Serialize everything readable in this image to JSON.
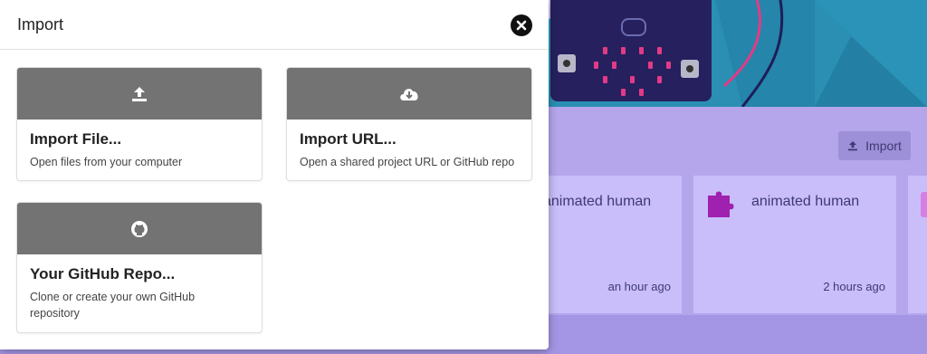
{
  "modal": {
    "title": "Import",
    "close_icon": "close-icon",
    "options": [
      {
        "title": "Import File...",
        "description": "Open files from your computer",
        "icon": "upload-icon"
      },
      {
        "title": "Import URL...",
        "description": "Open a shared project URL or GitHub repo",
        "icon": "cloud-download-icon"
      },
      {
        "title": "Your GitHub Repo...",
        "description": "Clone or create your own GitHub repository",
        "icon": "github-icon"
      }
    ]
  },
  "background": {
    "import_button_label": "Import",
    "projects": [
      {
        "name": "animated human",
        "time": "an hour ago"
      },
      {
        "name": "animated human",
        "time": "2 hours ago"
      }
    ]
  },
  "colors": {
    "option_header": "#737373",
    "app_background": "#b5a6ec",
    "project_card": "#c9befa",
    "puzzle_icon": "#a020b0",
    "hero": "#2a8fb3"
  }
}
